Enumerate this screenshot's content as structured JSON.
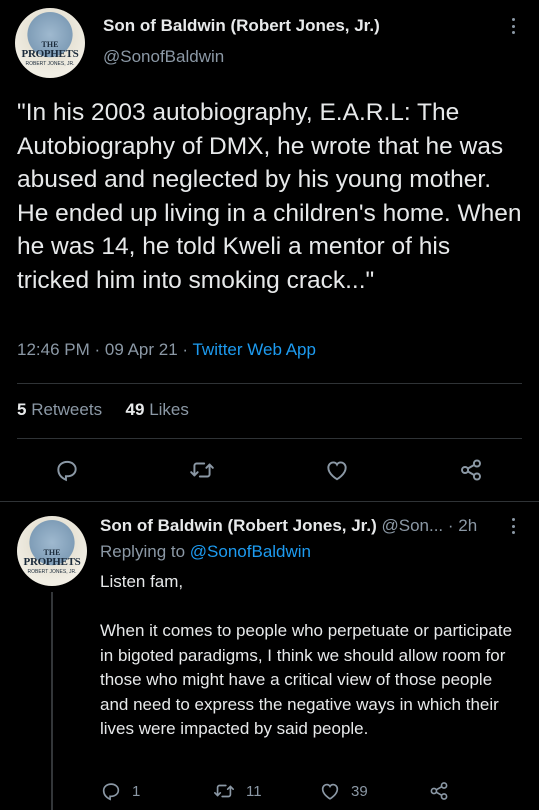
{
  "main_tweet": {
    "author_name": "Son of Baldwin (Robert Jones, Jr.)",
    "handle": "@SonofBaldwin",
    "avatar": {
      "line1": "THE",
      "line2": "PROPHETS",
      "line3": "ROBERT JONES, JR."
    },
    "text": "\"In his 2003 autobiography, E.A.R.L: The Autobiography of DMX, he wrote that he was abused and neglected by his young mother. He ended up living in a children's home. When he was 14, he told Kweli a mentor of his tricked him into smoking crack...\"",
    "time": "12:46 PM",
    "date": "09 Apr 21",
    "source": "Twitter Web App",
    "retweets_count": "5",
    "retweets_label": "Retweets",
    "likes_count": "49",
    "likes_label": "Likes",
    "icons": [
      "more-icon",
      "reply-icon",
      "retweet-icon",
      "like-icon",
      "share-icon"
    ]
  },
  "reply_tweet": {
    "author_name": "Son of Baldwin (Robert Jones, Jr.)",
    "handle": "@Son...",
    "time_ago": "2h",
    "replying_prefix": "Replying to",
    "replying_to": "@SonofBaldwin",
    "paragraph1": "Listen fam,",
    "paragraph2": "When it comes to people who perpetuate or participate in bigoted paradigms, I think we should allow room for those who might have a critical view of those people and need to express the negative ways in which their lives were impacted by said people.",
    "reply_count": "1",
    "retweet_count": "11",
    "like_count": "39"
  },
  "colors": {
    "background": "#000000",
    "text": "#e7e9ea",
    "secondary": "#8b98a5",
    "link": "#1d9bf0",
    "divider": "#2f3336"
  }
}
